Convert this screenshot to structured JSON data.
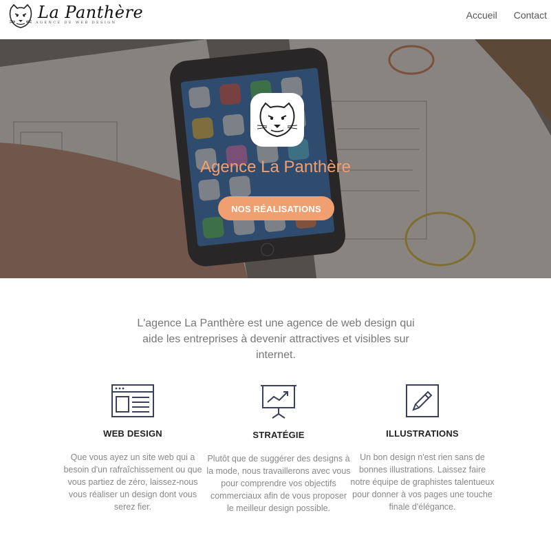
{
  "brand": {
    "name": "La Panthère",
    "tagline": "AGENCE DE WEB DESIGN",
    "logo_icon": "panther-head-icon"
  },
  "nav": {
    "items": [
      {
        "label": "Accueil"
      },
      {
        "label": "Contact"
      }
    ]
  },
  "hero": {
    "title": "Agence La Panthère",
    "cta_label": "NOS RÉALISATIONS",
    "badge_icon": "panther-head-icon",
    "accent_color": "#f0a070"
  },
  "intro": {
    "text": "L'agence La Panthère est une agence de web design qui aide les entreprises à devenir attractives et visibles sur internet."
  },
  "services": [
    {
      "icon": "browser-window-icon",
      "title": "WEB DESIGN",
      "text": "Que vous ayez un site web qui a besoin d'un rafraîchissement ou que vous partiez de zéro, laissez-nous vous réaliser un design dont vous serez fier."
    },
    {
      "icon": "presentation-chart-icon",
      "title": "STRATÉGIE",
      "text": "Plutôt que de suggérer des designs à la mode, nous travaillerons avec vous pour comprendre vos objectifs commerciaux afin de vous proposer le meilleur design possible."
    },
    {
      "icon": "pencil-edit-icon",
      "title": "ILLUSTRATIONS",
      "text": "Un bon design n'est rien sans de bonnes illustrations. Laissez faire notre équipe de graphistes talentueux pour donner à vos pages une touche finale d'élégance."
    }
  ]
}
